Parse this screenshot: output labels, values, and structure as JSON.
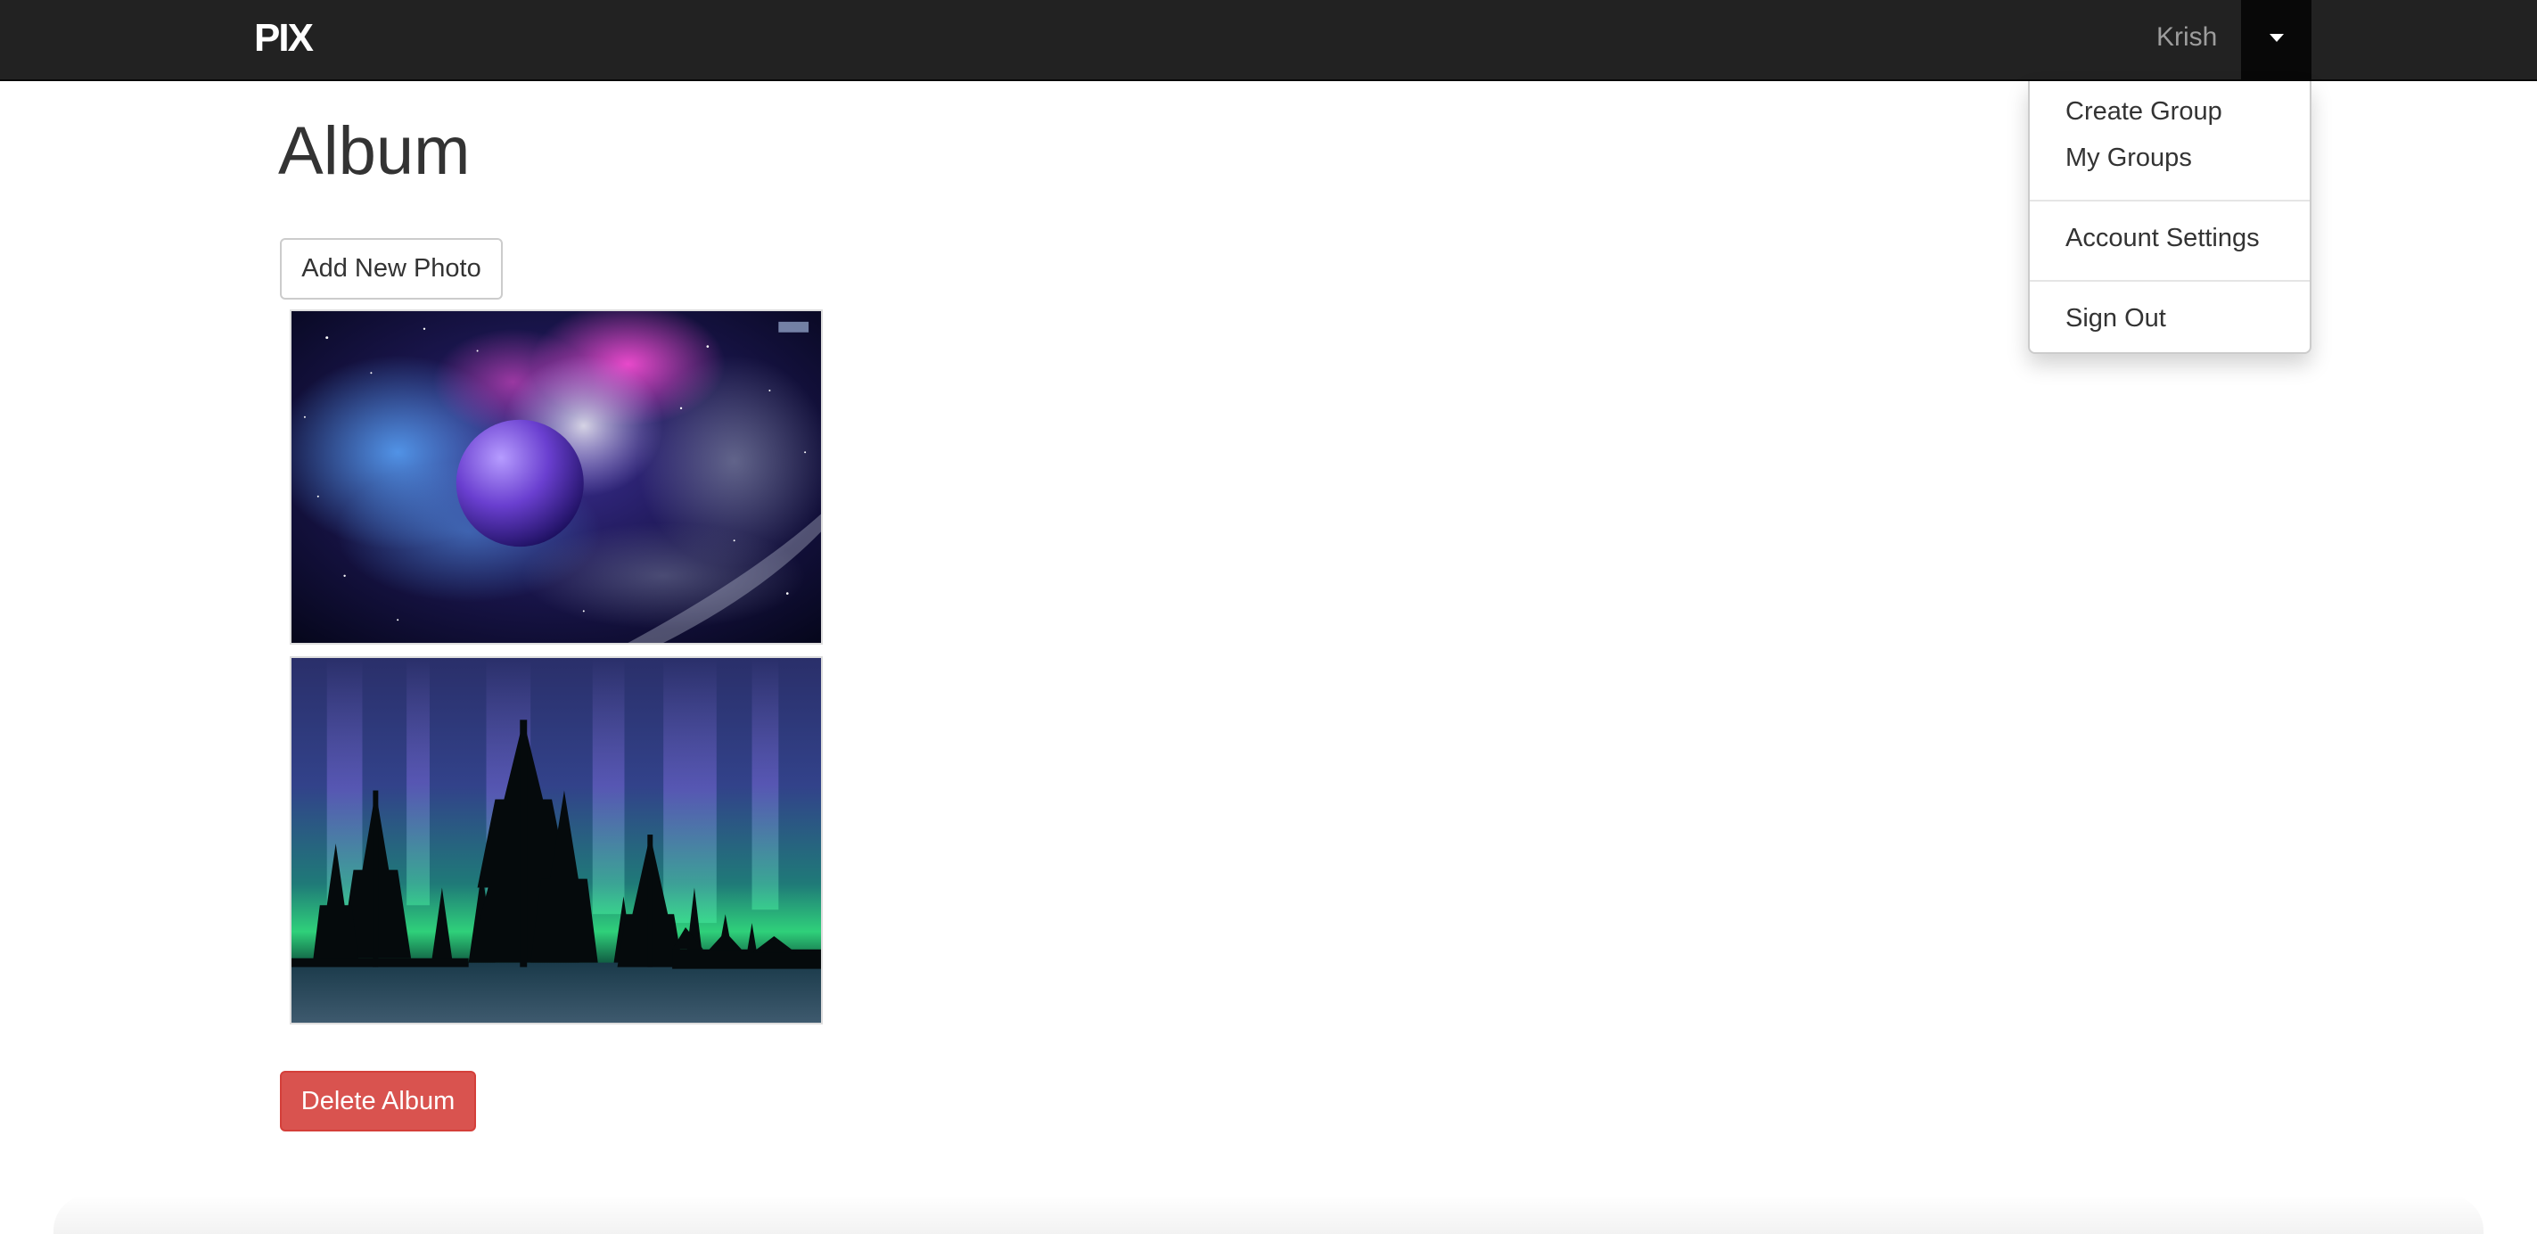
{
  "navbar": {
    "brand": "PIX",
    "user_name": "Krish",
    "menu": {
      "items": [
        {
          "label": "Create Group"
        },
        {
          "label": "My Groups"
        },
        {
          "label": "Account Settings"
        },
        {
          "label": "Sign Out"
        }
      ]
    }
  },
  "page": {
    "title": "Album",
    "add_photo_label": "Add New Photo",
    "delete_album_label": "Delete Album"
  },
  "photos": [
    {
      "subject": "space nebula with purple planet"
    },
    {
      "subject": "aurora borealis over pine tree silhouettes"
    }
  ],
  "colors": {
    "navbar_bg": "#222222",
    "danger": "#d9534f",
    "text": "#333333"
  }
}
